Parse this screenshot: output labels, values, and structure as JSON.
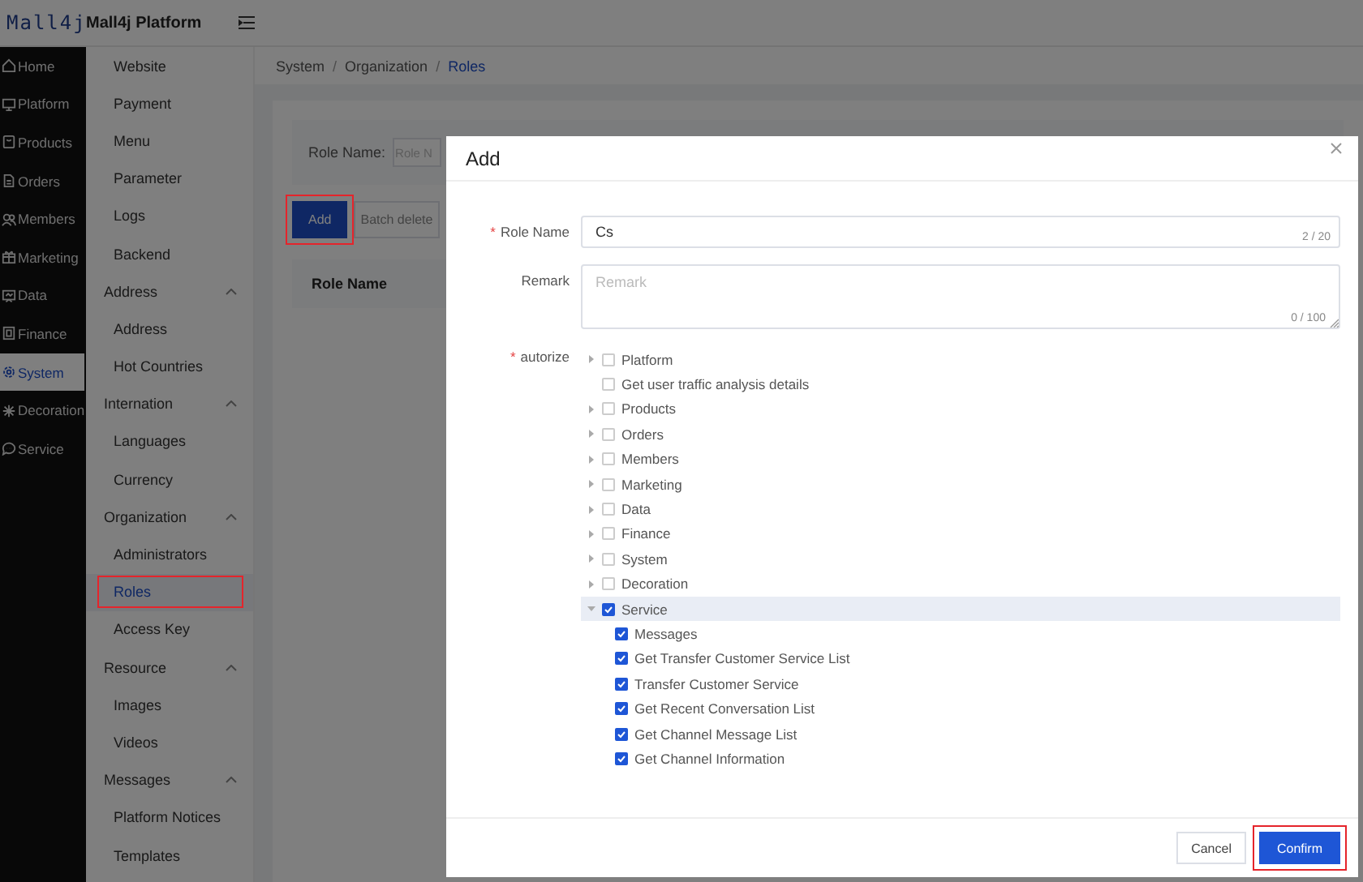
{
  "header": {
    "logo": "Mall4j",
    "title": "Mall4j Platform"
  },
  "rail": {
    "items": [
      {
        "label": "Home",
        "selected": false
      },
      {
        "label": "Platform",
        "selected": false
      },
      {
        "label": "Products",
        "selected": false
      },
      {
        "label": "Orders",
        "selected": false
      },
      {
        "label": "Members",
        "selected": false
      },
      {
        "label": "Marketing",
        "selected": false
      },
      {
        "label": "Data",
        "selected": false
      },
      {
        "label": "Finance",
        "selected": false
      },
      {
        "label": "System",
        "selected": true
      },
      {
        "label": "Decoration",
        "selected": false
      },
      {
        "label": "Service",
        "selected": false
      }
    ]
  },
  "submenu": {
    "items": [
      {
        "kind": "item",
        "label": "Website",
        "selected": false,
        "highlighted": false
      },
      {
        "kind": "item",
        "label": "Payment",
        "selected": false,
        "highlighted": false
      },
      {
        "kind": "item",
        "label": "Menu",
        "selected": false,
        "highlighted": false
      },
      {
        "kind": "item",
        "label": "Parameter",
        "selected": false,
        "highlighted": false
      },
      {
        "kind": "item",
        "label": "Logs",
        "selected": false,
        "highlighted": false
      },
      {
        "kind": "item",
        "label": "Backend",
        "selected": false,
        "highlighted": false
      },
      {
        "kind": "group",
        "label": "Address",
        "expanded": true
      },
      {
        "kind": "item",
        "label": "Address",
        "selected": false,
        "highlighted": false
      },
      {
        "kind": "item",
        "label": "Hot Countries",
        "selected": false,
        "highlighted": false
      },
      {
        "kind": "group",
        "label": "Internation",
        "expanded": true
      },
      {
        "kind": "item",
        "label": "Languages",
        "selected": false,
        "highlighted": false
      },
      {
        "kind": "item",
        "label": "Currency",
        "selected": false,
        "highlighted": false
      },
      {
        "kind": "group",
        "label": "Organization",
        "expanded": true
      },
      {
        "kind": "item",
        "label": "Administrators",
        "selected": false,
        "highlighted": false
      },
      {
        "kind": "item",
        "label": "Roles",
        "selected": true,
        "highlighted": true
      },
      {
        "kind": "item",
        "label": "Access Key",
        "selected": false,
        "highlighted": false
      },
      {
        "kind": "group",
        "label": "Resource",
        "expanded": true
      },
      {
        "kind": "item",
        "label": "Images",
        "selected": false,
        "highlighted": false
      },
      {
        "kind": "item",
        "label": "Videos",
        "selected": false,
        "highlighted": false
      },
      {
        "kind": "group",
        "label": "Messages",
        "expanded": true
      },
      {
        "kind": "item",
        "label": "Platform Notices",
        "selected": false,
        "highlighted": false
      },
      {
        "kind": "item",
        "label": "Templates",
        "selected": false,
        "highlighted": false
      }
    ]
  },
  "breadcrumb": {
    "separator": "/",
    "items": [
      "System",
      "Organization",
      "Roles"
    ]
  },
  "search": {
    "label": "Role Name:",
    "placeholder": "Role N"
  },
  "toolbar": [
    {
      "kind": "primary",
      "label": "Add",
      "highlighted": true
    },
    {
      "kind": "plain",
      "label": "Batch delete"
    }
  ],
  "table": {
    "columns": [
      "Role Name"
    ]
  },
  "dialog": {
    "title": "Add",
    "required_mark": "*",
    "fields": [
      {
        "kind": "input",
        "label": "Role Name",
        "required": true,
        "value": "Cs",
        "counter": "2 / 20"
      },
      {
        "kind": "textarea",
        "label": "Remark",
        "required": false,
        "placeholder": "Remark",
        "counter": "0 / 100"
      },
      {
        "kind": "tree",
        "label": "autorize",
        "required": true,
        "nodes": [
          {
            "label": "Platform",
            "checked": false,
            "expandable": true,
            "expanded": false,
            "highlighted": false
          },
          {
            "label": "Get user traffic analysis details",
            "checked": false,
            "expandable": false,
            "highlighted": false
          },
          {
            "label": "Products",
            "checked": false,
            "expandable": true,
            "expanded": false,
            "highlighted": false
          },
          {
            "label": "Orders",
            "checked": false,
            "expandable": true,
            "expanded": false,
            "highlighted": false
          },
          {
            "label": "Members",
            "checked": false,
            "expandable": true,
            "expanded": false,
            "highlighted": false
          },
          {
            "label": "Marketing",
            "checked": false,
            "expandable": true,
            "expanded": false,
            "highlighted": false
          },
          {
            "label": "Data",
            "checked": false,
            "expandable": true,
            "expanded": false,
            "highlighted": false
          },
          {
            "label": "Finance",
            "checked": false,
            "expandable": true,
            "expanded": false,
            "highlighted": false
          },
          {
            "label": "System",
            "checked": false,
            "expandable": true,
            "expanded": false,
            "highlighted": false
          },
          {
            "label": "Decoration",
            "checked": false,
            "expandable": true,
            "expanded": false,
            "highlighted": false
          },
          {
            "label": "Service",
            "checked": true,
            "expandable": true,
            "expanded": true,
            "highlighted": true,
            "children": [
              {
                "label": "Messages",
                "checked": true
              },
              {
                "label": "Get Transfer Customer Service List",
                "checked": true
              },
              {
                "label": "Transfer Customer Service",
                "checked": true
              },
              {
                "label": "Get Recent Conversation List",
                "checked": true
              },
              {
                "label": "Get Channel Message List",
                "checked": true
              },
              {
                "label": "Get Channel Information",
                "checked": true
              }
            ]
          }
        ]
      }
    ],
    "buttons": [
      {
        "kind": "cancel",
        "label": "Cancel"
      },
      {
        "kind": "confirm",
        "label": "Confirm",
        "highlighted": true
      }
    ]
  }
}
